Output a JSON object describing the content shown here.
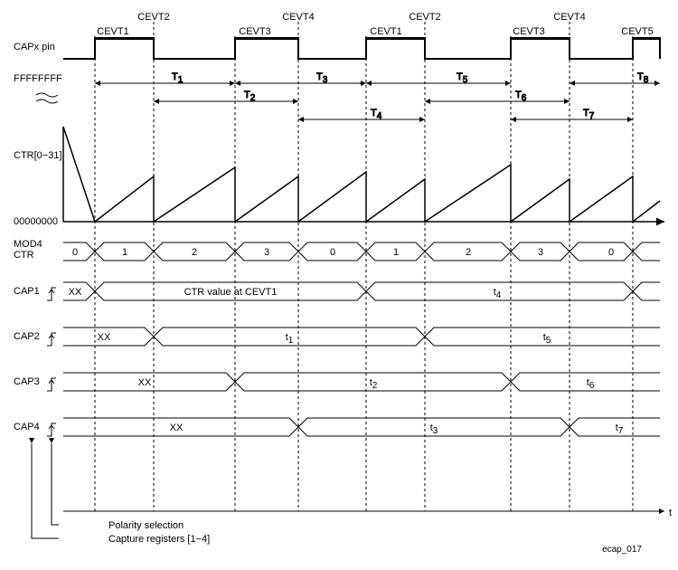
{
  "events": [
    "CEVT1",
    "CEVT2",
    "CEVT3",
    "CEVT4",
    "CEVT1",
    "CEVT2",
    "CEVT3",
    "CEVT4",
    "CEVT5"
  ],
  "labels": {
    "capx_pin": "CAPx pin",
    "ffffffff": "FFFFFFFF",
    "ctr_range": "CTR[0−31]",
    "zeros": "00000000",
    "mod4": "MOD4",
    "ctr": "CTR",
    "cap1": "CAP1",
    "cap2": "CAP2",
    "cap3": "CAP3",
    "cap4": "CAP4",
    "polarity": "Polarity selection",
    "capreg": "Capture registers [1−4]",
    "figid": "ecap_017",
    "time": "t"
  },
  "periods": [
    "T",
    "T",
    "T",
    "T",
    "T",
    "T",
    "T",
    "T"
  ],
  "period_subs": [
    "1",
    "2",
    "3",
    "4",
    "5",
    "6",
    "7",
    "8"
  ],
  "mod4_seq": [
    "0",
    "1",
    "2",
    "3",
    "0",
    "1",
    "2",
    "3",
    "0"
  ],
  "cap1_vals": [
    "XX",
    "CTR value at CEVT1",
    "t",
    "4"
  ],
  "cap2_vals": [
    "XX",
    "t",
    "1",
    "t",
    "5"
  ],
  "cap3_vals": [
    "XX",
    "t",
    "2",
    "t",
    "6"
  ],
  "cap4_vals": [
    "XX",
    "t",
    "3",
    "t",
    "7"
  ]
}
